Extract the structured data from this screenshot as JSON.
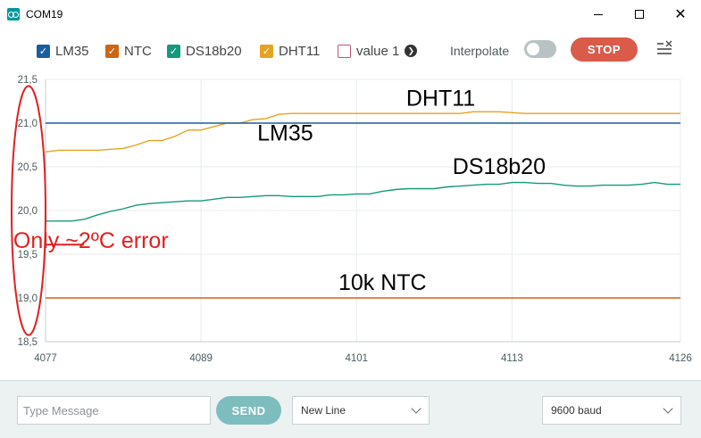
{
  "window": {
    "title": "COM19",
    "close_glyph": "✕"
  },
  "toolbar": {
    "legend": [
      {
        "label": "LM35",
        "color": "#1a5e9e",
        "checked": true
      },
      {
        "label": "NTC",
        "color": "#cc6516",
        "checked": true
      },
      {
        "label": "DS18b20",
        "color": "#14997d",
        "checked": true
      },
      {
        "label": "DHT11",
        "color": "#e6a31e",
        "checked": true
      },
      {
        "label": "value 1",
        "color": "#c2557b",
        "checked": false
      }
    ],
    "checkmark": "✓",
    "info_glyph": "❯",
    "interpolate_label": "Interpolate",
    "interpolate_on": false,
    "stop_label": "STOP",
    "clear_icon": "clear-list-icon"
  },
  "chart_data": {
    "type": "line",
    "ylim": [
      18.5,
      21.5
    ],
    "xlim": [
      4077,
      4126
    ],
    "yticks": [
      "21,5",
      "21,0",
      "20,5",
      "20,0",
      "19,5",
      "19,0",
      "18,5"
    ],
    "ytick_values": [
      21.5,
      21.0,
      20.5,
      20.0,
      19.5,
      19.0,
      18.5
    ],
    "xticks": [
      "4077",
      "4089",
      "4101",
      "4113",
      "4126"
    ],
    "xtick_values": [
      4077,
      4089,
      4101,
      4113,
      4126
    ],
    "grid": true,
    "series": [
      {
        "color": "#e6a31e",
        "x": [
          4077,
          4078,
          4080,
          4081,
          4083,
          4084,
          4085,
          4086,
          4087,
          4088,
          4089,
          4090,
          4091,
          4092,
          4093,
          4094,
          4095,
          4096,
          4097,
          4098,
          4100,
          4102,
          4105,
          4107,
          4109,
          4110,
          4112,
          4114,
          4116,
          4118,
          4120,
          4122,
          4124,
          4126
        ],
        "y": [
          20.67,
          20.69,
          20.69,
          20.69,
          20.71,
          20.75,
          20.8,
          20.8,
          20.85,
          20.92,
          20.92,
          20.96,
          21.0,
          21.0,
          21.04,
          21.05,
          21.1,
          21.11,
          21.11,
          21.11,
          21.11,
          21.11,
          21.11,
          21.11,
          21.11,
          21.13,
          21.13,
          21.11,
          21.11,
          21.11,
          21.11,
          21.11,
          21.11,
          21.11
        ]
      },
      {
        "color": "#1a5e9e",
        "x": [
          4077,
          4126
        ],
        "y": [
          21.0,
          21.0
        ]
      },
      {
        "color": "#14997d",
        "x": [
          4077,
          4078,
          4079,
          4080,
          4081,
          4082,
          4083,
          4084,
          4085,
          4086,
          4087,
          4088,
          4089,
          4090,
          4091,
          4092,
          4093,
          4094,
          4095,
          4096,
          4097,
          4098,
          4099,
          4100,
          4101,
          4102,
          4103,
          4104,
          4105,
          4106,
          4107,
          4108,
          4109,
          4110,
          4111,
          4112,
          4113,
          4114,
          4115,
          4116,
          4117,
          4118,
          4119,
          4120,
          4121,
          4122,
          4123,
          4124,
          4125,
          4126
        ],
        "y": [
          19.88,
          19.88,
          19.88,
          19.9,
          19.95,
          19.99,
          20.02,
          20.06,
          20.08,
          20.09,
          20.1,
          20.11,
          20.11,
          20.13,
          20.15,
          20.15,
          20.16,
          20.17,
          20.17,
          20.16,
          20.16,
          20.16,
          20.18,
          20.18,
          20.19,
          20.19,
          20.22,
          20.24,
          20.25,
          20.25,
          20.25,
          20.27,
          20.28,
          20.29,
          20.3,
          20.3,
          20.32,
          20.32,
          20.31,
          20.31,
          20.29,
          20.28,
          20.28,
          20.29,
          20.29,
          20.29,
          20.3,
          20.32,
          20.3,
          20.3
        ]
      },
      {
        "color": "#cc6516",
        "x": [
          4077,
          4126
        ],
        "y": [
          19.0,
          19.0
        ]
      }
    ],
    "annotations": [
      {
        "text": "DHT11",
        "x": 4107.5,
        "y": 21.2
      },
      {
        "text": "LM35",
        "x": 4095.5,
        "y": 20.8
      },
      {
        "text": "DS18b20",
        "x": 4112,
        "y": 20.42
      },
      {
        "text": "10k NTC",
        "x": 4103,
        "y": 19.09
      },
      {
        "text": "Only ~2ºC error",
        "color": "#e02020",
        "x": 4080.5,
        "y": 19.57
      }
    ]
  },
  "bottom": {
    "message_placeholder": "Type Message",
    "message_value": "",
    "send_label": "SEND",
    "line_ending": "New Line",
    "baud": "9600 baud"
  }
}
